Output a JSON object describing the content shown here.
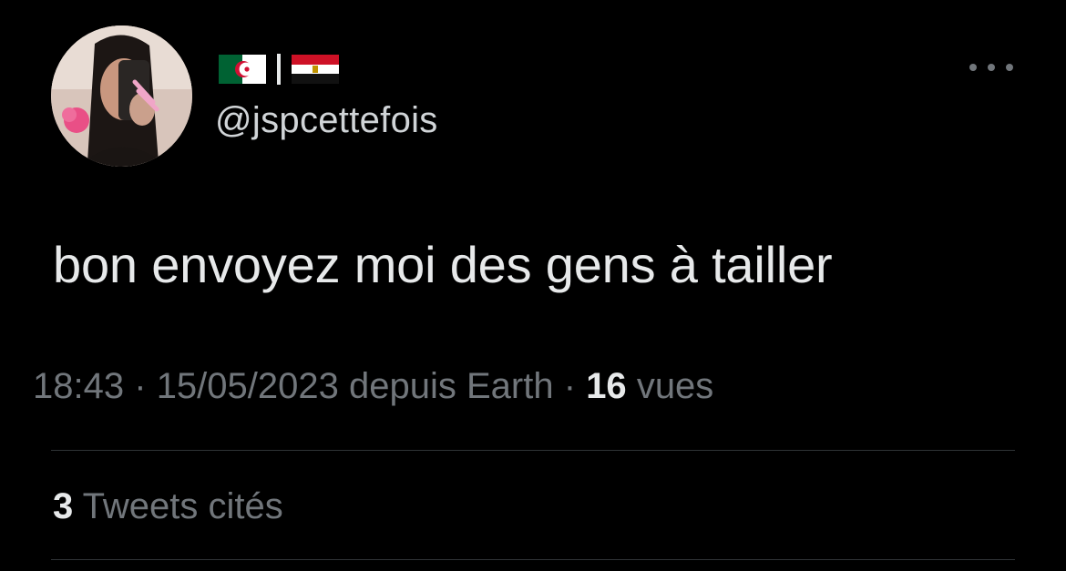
{
  "author": {
    "display_name_flags": [
      "algeria-flag",
      "egypt-flag"
    ],
    "handle": "@jspcettefois",
    "avatar_icon": "avatar"
  },
  "tweet": {
    "text": "bon envoyez moi des gens à tailler"
  },
  "meta": {
    "time": "18:43",
    "separator": "·",
    "date": "15/05/2023",
    "source": "depuis Earth",
    "views_count": "16",
    "views_label": "vues"
  },
  "engagement": {
    "quotes_count": "3",
    "quotes_label": "Tweets cités"
  },
  "colors": {
    "background": "#000000",
    "primary_text": "#e7e9ea",
    "secondary_text": "#71767b",
    "divider": "#2f3336"
  }
}
